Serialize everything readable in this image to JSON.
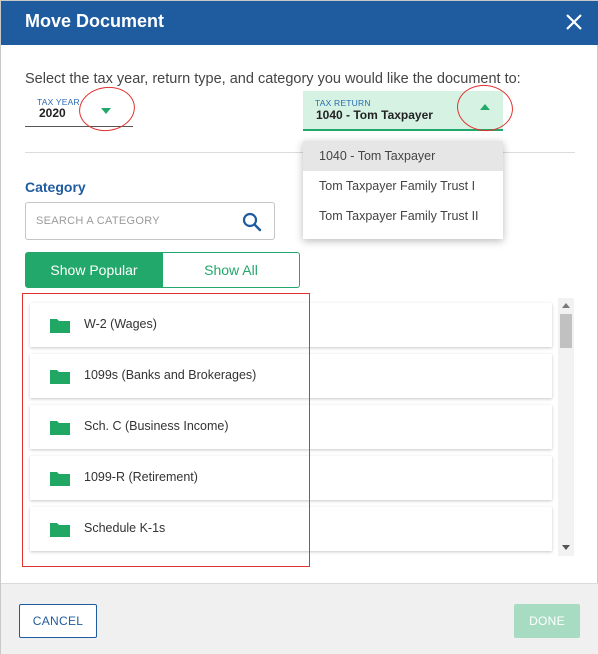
{
  "dialog": {
    "title": "Move Document"
  },
  "instructions": "Select the tax year, return type, and category you would like the document to:",
  "tax_year": {
    "label": "TAX YEAR",
    "value": "2020"
  },
  "tax_return": {
    "label": "TAX RETURN",
    "value": "1040 - Tom Taxpayer",
    "options": [
      "1040 - Tom Taxpayer",
      "Tom Taxpayer Family Trust I",
      "Tom Taxpayer Family Trust II"
    ]
  },
  "category": {
    "heading": "Category",
    "search_placeholder": "SEARCH A CATEGORY",
    "toggle_popular": "Show Popular",
    "toggle_all": "Show All",
    "items": [
      "W-2 (Wages)",
      "1099s (Banks and Brokerages)",
      "Sch. C (Business Income)",
      "1099-R (Retirement)",
      "Schedule K-1s"
    ]
  },
  "footer": {
    "cancel_label": "CANCEL",
    "done_label": "DONE"
  },
  "colors": {
    "header_blue": "#1f5b9f",
    "accent_green": "#22a86a",
    "annotation_red": "#e0322e"
  }
}
